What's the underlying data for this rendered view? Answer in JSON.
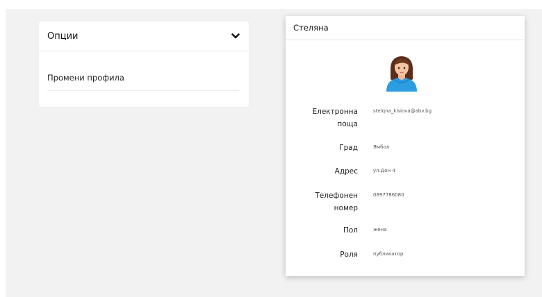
{
  "options": {
    "title": "Опции",
    "items": [
      {
        "label": "Промени профила"
      }
    ]
  },
  "profile": {
    "name": "Стеляна",
    "fields": [
      {
        "label_line1": "Електронна",
        "label_line2": "поща",
        "value": "stelqna_kisiova@abv.bg"
      },
      {
        "label_line1": "Град",
        "label_line2": "",
        "value": "Ямбол"
      },
      {
        "label_line1": "Адрес",
        "label_line2": "",
        "value": "ул.Дон 4"
      },
      {
        "label_line1": "Телефонен",
        "label_line2": "номер",
        "value": "0897786080"
      },
      {
        "label_line1": "Пол",
        "label_line2": "",
        "value": "жена"
      },
      {
        "label_line1": "Роля",
        "label_line2": "",
        "value": "публикатор"
      }
    ]
  },
  "colors": {
    "avatar_shirt": "#2b9de0",
    "avatar_hair": "#5a2e1a"
  }
}
